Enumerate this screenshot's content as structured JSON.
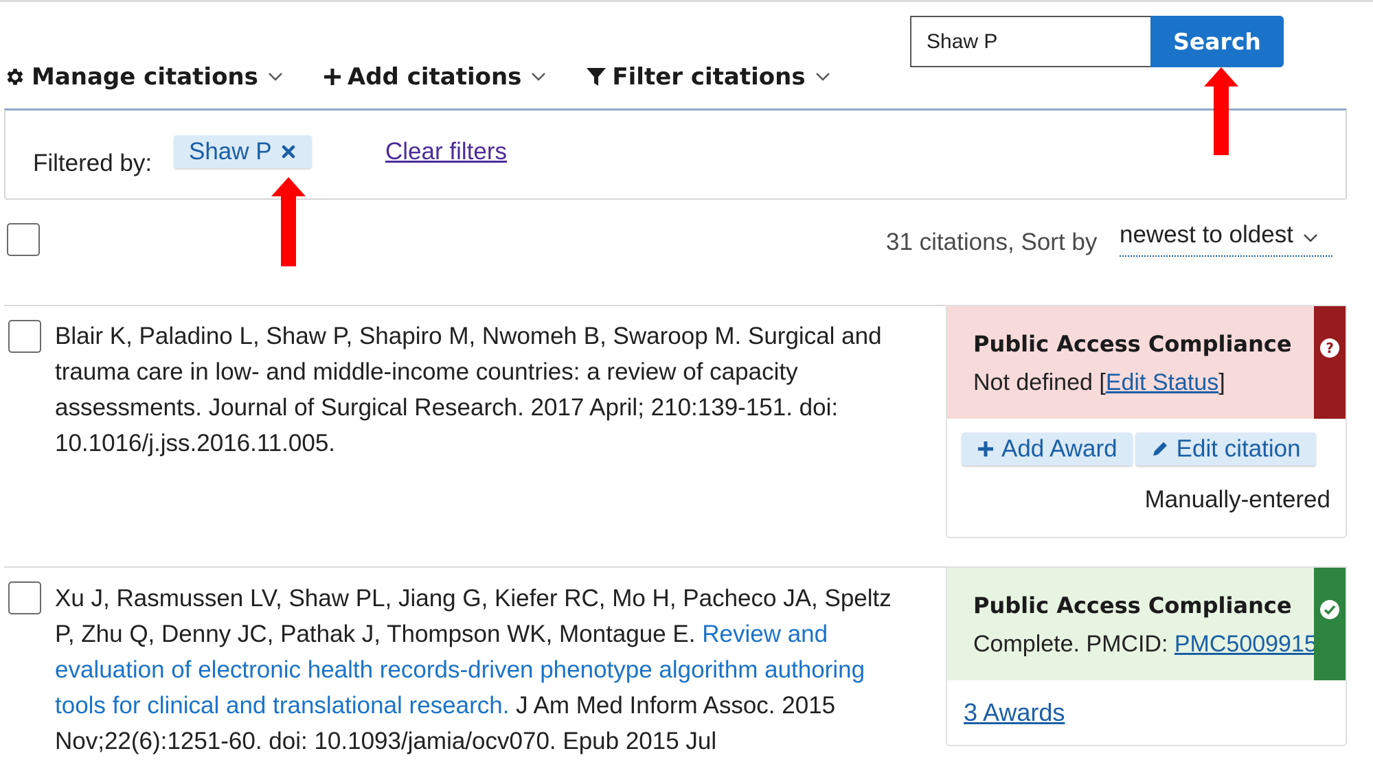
{
  "search": {
    "value": "Shaw P",
    "button_label": "Search"
  },
  "toolbar": {
    "manage_label": "Manage citations",
    "add_label": "Add citations",
    "filter_label": "Filter citations"
  },
  "filters": {
    "label": "Filtered by:",
    "active_chip": "Shaw P",
    "clear_label": "Clear filters"
  },
  "list": {
    "count_text": "31 citations, Sort by",
    "sort_value": "newest to oldest"
  },
  "citations": [
    {
      "text": "Blair K, Paladino L, Shaw P, Shapiro M, Nwomeh B, Swaroop M. Surgical and trauma care in low- and middle-income countries: a review of capacity assessments. Journal of Surgical Research. 2017 April; 210:139-151. doi: 10.1016/j.jss.2016.11.005.",
      "compliance": {
        "title": "Public Access Compliance",
        "status_text": "Not defined",
        "bracket_open": "[",
        "edit_status_label": "Edit Status",
        "bracket_close": "]",
        "color": "#981b1e"
      },
      "add_award_label": "Add Award",
      "edit_citation_label": "Edit citation",
      "source": "Manually-entered"
    },
    {
      "authors": "Xu J, Rasmussen LV, Shaw PL, Jiang G, Kiefer RC, Mo H, Pacheco JA, Speltz P, Zhu Q, Denny JC, Pathak J, Thompson WK, Montague E. ",
      "title_link": "Review and evaluation of electronic health records-driven phenotype algorithm authoring tools for clinical and translational research.",
      "rest": " J Am Med Inform Assoc. 2015 Nov;22(6):1251-60. doi: 10.1093/jamia/ocv070. Epub 2015 Jul",
      "compliance": {
        "title": "Public Access Compliance",
        "status_prefix": "Complete. PMCID: ",
        "pmcid": "PMC5009915",
        "color": "#2e8540"
      },
      "awards_label": "3 Awards"
    }
  ],
  "colors": {
    "primary": "#1a73c8",
    "chip_bg": "#dbeaf7",
    "annotation_arrow": "#ff0000"
  }
}
